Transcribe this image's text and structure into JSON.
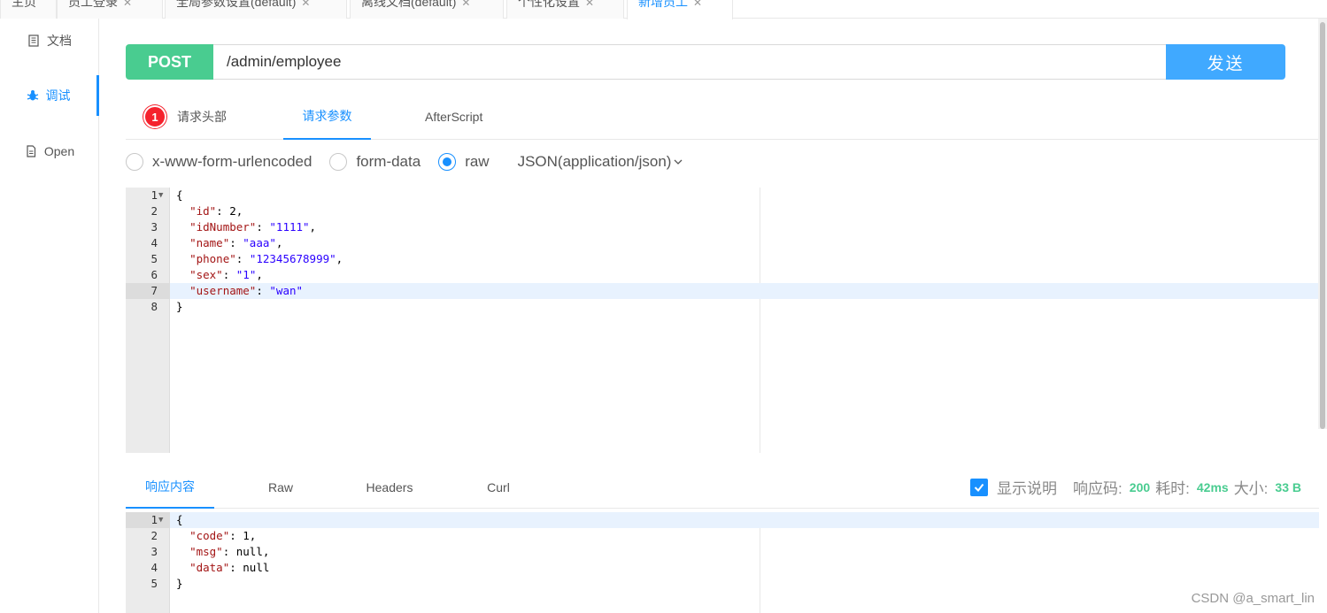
{
  "top_tabs": [
    {
      "label": "主页",
      "closable": false
    },
    {
      "label": "员工登录",
      "closable": true
    },
    {
      "label": "全局参数设置(default)",
      "closable": true
    },
    {
      "label": "离线文档(default)",
      "closable": true
    },
    {
      "label": "个性化设置",
      "closable": true
    },
    {
      "label": "新增员工",
      "closable": true,
      "active": true
    }
  ],
  "sidebar": {
    "items": [
      {
        "label": "文档",
        "icon": "document-icon"
      },
      {
        "label": "调试",
        "icon": "bug-icon",
        "active": true
      },
      {
        "label": "Open",
        "icon": "file-icon"
      }
    ]
  },
  "request": {
    "method": "POST",
    "url": "/admin/employee",
    "send_label": "发送"
  },
  "request_tabs": {
    "headers_badge": "1",
    "headers_label": "请求头部",
    "params_label": "请求参数",
    "afterscript_label": "AfterScript"
  },
  "body_types": {
    "options": [
      "x-www-form-urlencoded",
      "form-data",
      "raw"
    ],
    "selected": "raw",
    "content_type": "JSON(application/json)"
  },
  "request_body": {
    "lines": [
      "{",
      "  \"id\": 2,",
      "  \"idNumber\": \"1111\",",
      "  \"name\": \"aaa\",",
      "  \"phone\": \"12345678999\",",
      "  \"sex\": \"1\",",
      "  \"username\": \"wan\"",
      "}"
    ],
    "active_line": 7
  },
  "response_tabs": {
    "content_label": "响应内容",
    "raw_label": "Raw",
    "headers_label": "Headers",
    "curl_label": "Curl"
  },
  "response_meta": {
    "show_desc_label": "显示说明",
    "code_label": "响应码:",
    "code_value": "200",
    "time_label": "耗时:",
    "time_value": "42ms",
    "size_label": "大小:",
    "size_value": "33 B"
  },
  "response_body": {
    "lines": [
      "{",
      "  \"code\": 1,",
      "  \"msg\": null,",
      "  \"data\": null",
      "}"
    ],
    "active_line": 1
  },
  "watermark": "CSDN @a_smart_lin",
  "colors": {
    "accent": "#1890ff",
    "method_post": "#49cc90",
    "send_button": "#40a9ff",
    "badge": "#f5222d"
  }
}
